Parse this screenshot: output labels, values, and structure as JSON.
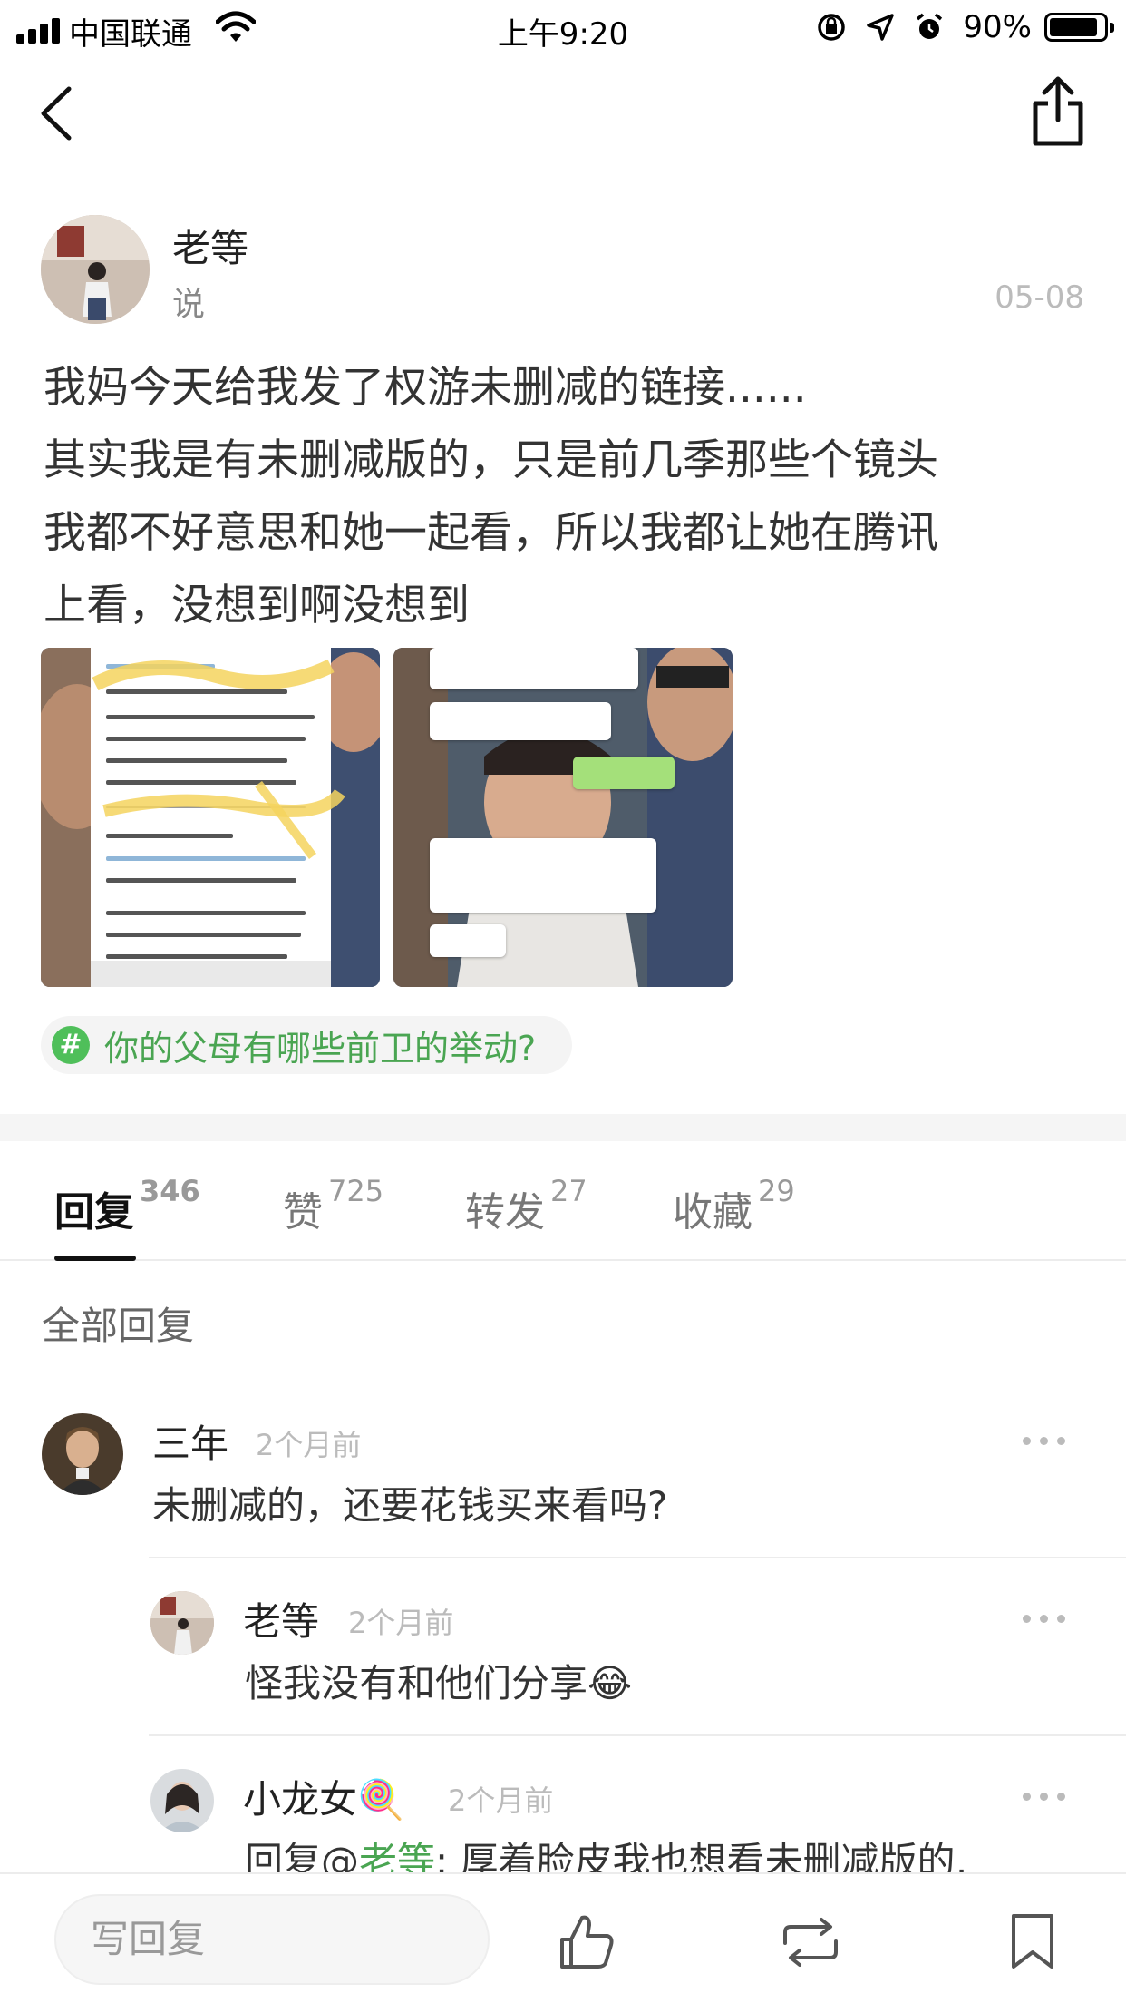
{
  "status_bar": {
    "carrier": "中国联通",
    "time": "上午9:20",
    "battery_percent": "90%",
    "battery_level": 0.9
  },
  "post": {
    "author": "老等",
    "action": "说",
    "date": "05-08",
    "body": "我妈今天给我发了权游未删减的链接......\n其实我是有未删减版的，只是前几季那些个镜头\n我都不好意思和她一起看，所以我都让她在腾讯\n上看，没想到啊没想到",
    "topic": "你的父母有哪些前卫的举动?"
  },
  "tabs": [
    {
      "label": "回复",
      "count": "346"
    },
    {
      "label": "赞",
      "count": "725"
    },
    {
      "label": "转发",
      "count": "27"
    },
    {
      "label": "收藏",
      "count": "29"
    }
  ],
  "section_title": "全部回复",
  "comments": [
    {
      "name": "三年",
      "time": "2个月前",
      "text": "未删减的，还要花钱买来看吗?"
    },
    {
      "name": "老等",
      "time": "2个月前",
      "text": "怪我没有和他们分享😂"
    },
    {
      "name": "小龙女🍭",
      "time": "2个月前",
      "prefix": "回复@",
      "mention": "老等",
      "text": ": 厚着脸皮我也想看未删减版的,"
    }
  ],
  "bottom_bar": {
    "reply_placeholder": "写回复"
  },
  "icons": {
    "like": "thumbs-up-icon",
    "repost": "repost-icon",
    "bookmark": "bookmark-icon"
  },
  "colors": {
    "accent_green": "#4aa552",
    "topic_badge": "#4fbf5a"
  }
}
